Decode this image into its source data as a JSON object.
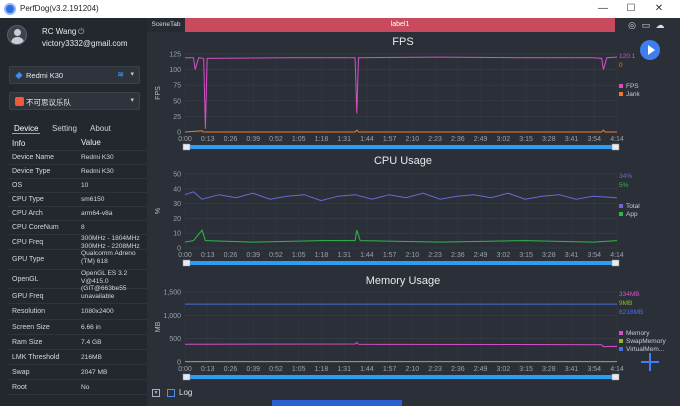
{
  "window": {
    "title": "PerfDog(v3.2.191204)",
    "min_glyph": "—",
    "max_glyph": "☐",
    "close_glyph": "✕"
  },
  "profile": {
    "name": "RC Wang",
    "email": "victory3332@gmail.com",
    "icons": [
      "avatar-icon",
      "power-icon"
    ]
  },
  "device_select": {
    "label": "Redmi K30",
    "icon": "device-icon",
    "status_icon": "wifi-icon"
  },
  "app_select": {
    "label": "不可思议乐队",
    "icon": "app-icon"
  },
  "tabs": [
    {
      "label": "Device",
      "active": true
    },
    {
      "label": "Setting",
      "active": false
    },
    {
      "label": "About",
      "active": false
    }
  ],
  "info_table": {
    "headers": [
      "Info",
      "Value"
    ],
    "rows": [
      [
        "Device Name",
        "Redmi K30"
      ],
      [
        "Device Type",
        "Redmi K30"
      ],
      [
        "OS",
        "10"
      ],
      [
        "CPU Type",
        "sm6150"
      ],
      [
        "CPU Arch",
        "arm64-v8a"
      ],
      [
        "CPU CoreNum",
        "8"
      ],
      [
        "CPU Freq",
        "300MHz - 1804MHz 300MHz - 2208MHz"
      ],
      [
        "GPU Type",
        "Qualcomm Adreno (TM) 618"
      ],
      [
        "OpenGL",
        "OpenGL ES 3.2 V@415.0 (GIT@663be55"
      ],
      [
        "GPU Freq",
        "unavailable"
      ],
      [
        "Resolution",
        "1080x2400"
      ],
      [
        "Screen Size",
        "6.66 in"
      ],
      [
        "Ram Size",
        "7.4 GB"
      ],
      [
        "LMK Threshold",
        "216MB"
      ],
      [
        "Swap",
        "2047 MB"
      ],
      [
        "Root",
        "No"
      ]
    ]
  },
  "topbar": {
    "scene_tab": "SceneTab",
    "label": "label1",
    "icons": [
      "location-icon",
      "folder-icon",
      "cloud-icon"
    ]
  },
  "time_ticks": [
    "0:00",
    "0:13",
    "0:26",
    "0:39",
    "0:52",
    "1:05",
    "1:18",
    "1:31",
    "1:44",
    "1:57",
    "2:10",
    "2:23",
    "2:36",
    "2:49",
    "3:02",
    "3:15",
    "3:28",
    "3:41",
    "3:54",
    "4:14"
  ],
  "colors": {
    "fps": "#d64fc6",
    "jank": "#f07a28",
    "cpu_total": "#6a68d8",
    "cpu_app": "#2fb84a",
    "memory": "#d64fc6",
    "swap": "#8dbb2a",
    "virtual": "#4a6ee0",
    "accent": "#3e7ef0",
    "label_bar": "#c94a5c"
  },
  "chart_data": [
    {
      "type": "line",
      "title": "FPS",
      "ylabel": "FPS",
      "ylim": [
        0,
        125
      ],
      "yticks": [
        "0",
        "25",
        "50",
        "75",
        "100",
        "125"
      ],
      "grid": true,
      "legend_position": "right",
      "current_values": [
        "120.1",
        "0"
      ],
      "series": [
        {
          "name": "FPS",
          "points": [
            [
              0,
              119
            ],
            [
              5,
              119
            ],
            [
              6,
              100
            ],
            [
              8,
              119
            ],
            [
              11,
              118
            ],
            [
              12,
              5
            ],
            [
              13,
              118
            ],
            [
              60,
              119
            ],
            [
              100,
              119
            ],
            [
              101,
              30
            ],
            [
              102,
              119
            ],
            [
              150,
              120
            ],
            [
              200,
              119
            ],
            [
              240,
              119
            ],
            [
              245,
              118
            ],
            [
              246,
              100
            ],
            [
              248,
              119
            ],
            [
              254,
              120
            ]
          ]
        },
        {
          "name": "Jank",
          "points": [
            [
              0,
              0
            ],
            [
              10,
              2
            ],
            [
              11,
              0
            ],
            [
              100,
              0
            ],
            [
              101,
              3
            ],
            [
              102,
              0
            ],
            [
              245,
              0
            ],
            [
              246,
              3
            ],
            [
              247,
              0
            ],
            [
              254,
              0
            ]
          ]
        }
      ]
    },
    {
      "type": "line",
      "title": "CPU Usage",
      "ylabel": "%",
      "ylim": [
        0,
        50
      ],
      "yticks": [
        "0",
        "10",
        "20",
        "30",
        "40",
        "50"
      ],
      "grid": true,
      "legend_position": "right",
      "current_values": [
        "34%",
        "5%"
      ],
      "series": [
        {
          "name": "Total",
          "points": [
            [
              0,
              36
            ],
            [
              5,
              38
            ],
            [
              10,
              33
            ],
            [
              20,
              36
            ],
            [
              30,
              34
            ],
            [
              40,
              37
            ],
            [
              50,
              33
            ],
            [
              60,
              35
            ],
            [
              70,
              36
            ],
            [
              80,
              32
            ],
            [
              90,
              35
            ],
            [
              100,
              36
            ],
            [
              110,
              33
            ],
            [
              120,
              36
            ],
            [
              130,
              34
            ],
            [
              140,
              37
            ],
            [
              150,
              33
            ],
            [
              160,
              35
            ],
            [
              170,
              36
            ],
            [
              180,
              34
            ],
            [
              190,
              37
            ],
            [
              200,
              33
            ],
            [
              210,
              35
            ],
            [
              220,
              36
            ],
            [
              230,
              33
            ],
            [
              240,
              35
            ],
            [
              254,
              34
            ]
          ]
        },
        {
          "name": "App",
          "points": [
            [
              0,
              4
            ],
            [
              5,
              5
            ],
            [
              10,
              12
            ],
            [
              12,
              5
            ],
            [
              40,
              4
            ],
            [
              80,
              5
            ],
            [
              100,
              5
            ],
            [
              101,
              12
            ],
            [
              103,
              5
            ],
            [
              150,
              4
            ],
            [
              200,
              5
            ],
            [
              240,
              4
            ],
            [
              254,
              5
            ]
          ]
        }
      ]
    },
    {
      "type": "line",
      "title": "Memory Usage",
      "ylabel": "MB",
      "ylim": [
        0,
        1500
      ],
      "yticks": [
        "0",
        "500",
        "1,000",
        "1,500"
      ],
      "grid": true,
      "legend_position": "right",
      "current_values": [
        "334MB",
        "9MB",
        "6218MB"
      ],
      "series": [
        {
          "name": "Memory",
          "points": [
            [
              0,
              380
            ],
            [
              100,
              385
            ],
            [
              101,
              420
            ],
            [
              102,
              380
            ],
            [
              200,
              375
            ],
            [
              245,
              370
            ],
            [
              246,
              330
            ],
            [
              254,
              334
            ]
          ]
        },
        {
          "name": "SwapMemory",
          "points": [
            [
              0,
              9
            ],
            [
              254,
              9
            ]
          ]
        },
        {
          "name": "VirtualMem...",
          "points": [
            [
              0,
              1240
            ],
            [
              254,
              1240
            ]
          ]
        }
      ]
    }
  ],
  "log": {
    "label": "Log"
  }
}
